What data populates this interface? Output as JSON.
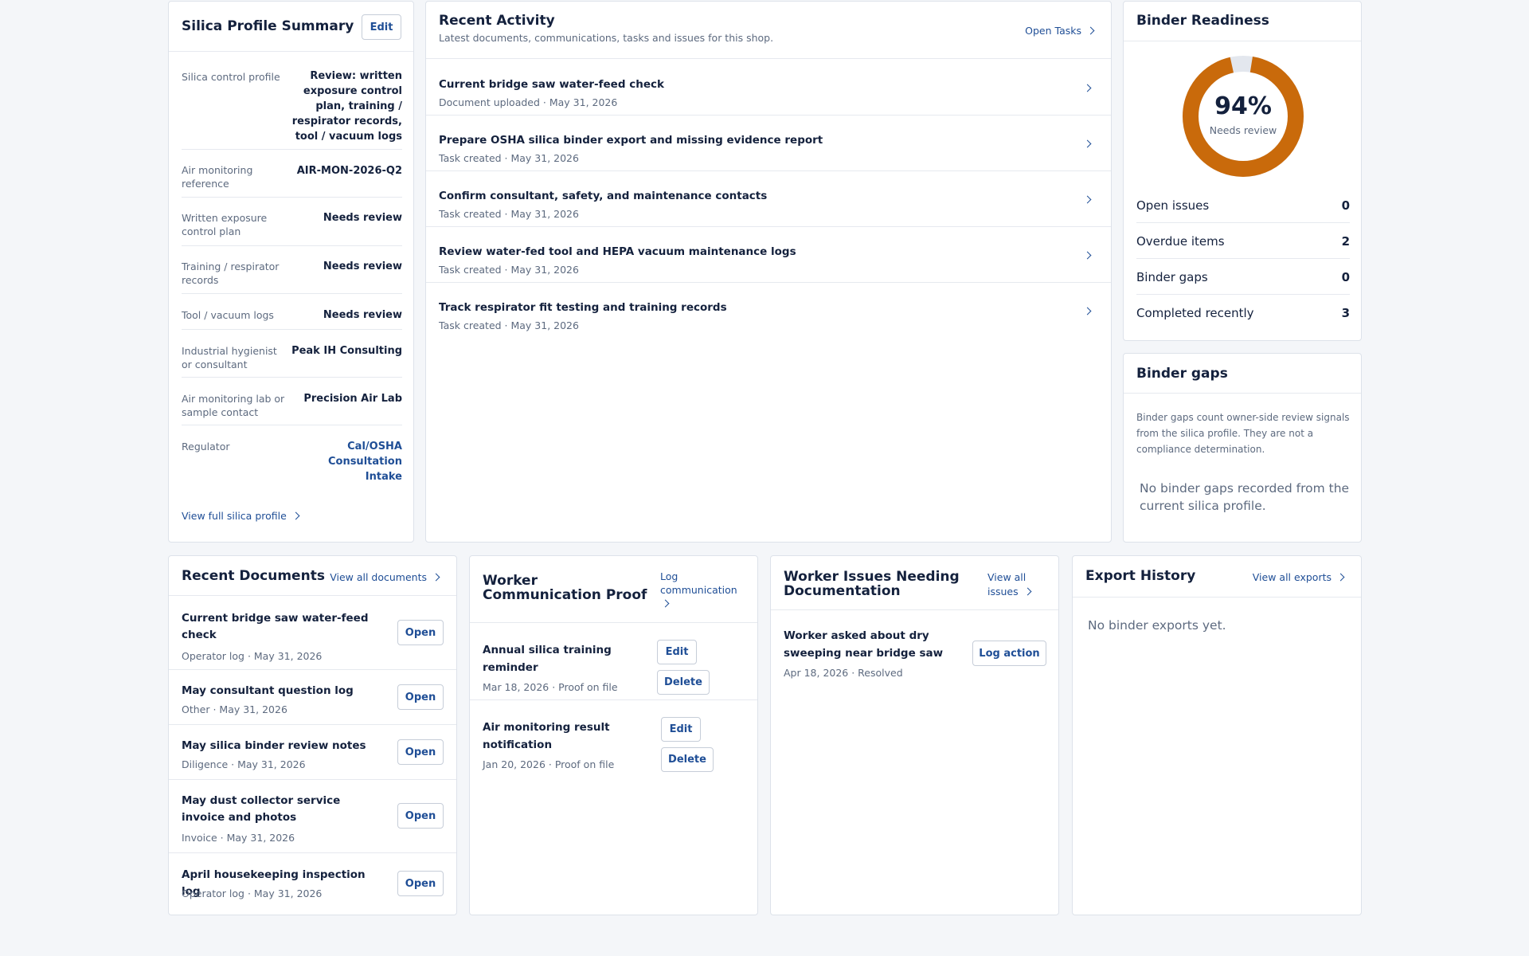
{
  "silica_profile": {
    "title": "Silica Profile Summary",
    "edit_label": "Edit",
    "rows": [
      {
        "label": "Silica control profile",
        "value": "Review: written exposure control plan, training / respirator records, tool / vacuum logs"
      },
      {
        "label": "Air monitoring reference",
        "value": "AIR-MON-2026-Q2"
      },
      {
        "label": "Written exposure control plan",
        "value": "Needs review"
      },
      {
        "label": "Training / respirator records",
        "value": "Needs review"
      },
      {
        "label": "Tool / vacuum logs",
        "value": "Needs review"
      },
      {
        "label": "Industrial hygienist or consultant",
        "value": "Peak IH Consulting"
      },
      {
        "label": "Air monitoring lab or sample contact",
        "value": "Precision Air Lab"
      },
      {
        "label": "Regulator",
        "value": "Cal/OSHA Consultation Intake"
      }
    ],
    "footer_link": "View full silica profile"
  },
  "recent_activity": {
    "title": "Recent Activity",
    "subtitle": "Latest documents, communications, tasks and issues for this shop.",
    "open_tasks_label": "Open Tasks",
    "items": [
      {
        "title": "Current bridge saw water-feed check",
        "meta": "Document uploaded · May 31, 2026"
      },
      {
        "title": "Prepare OSHA silica binder export and missing evidence report",
        "meta": "Task created · May 31, 2026"
      },
      {
        "title": "Confirm consultant, safety, and maintenance contacts",
        "meta": "Task created · May 31, 2026"
      },
      {
        "title": "Review water-fed tool and HEPA vacuum maintenance logs",
        "meta": "Task created · May 31, 2026"
      },
      {
        "title": "Track respirator fit testing and training records",
        "meta": "Task created · May 31, 2026"
      }
    ]
  },
  "binder_readiness": {
    "title": "Binder Readiness",
    "percent_value": 94,
    "percent_text": "94%",
    "status": "Needs review",
    "ring_color": "#c96a0b",
    "track_color": "#e3e7ee",
    "stats": [
      {
        "label": "Open issues",
        "value": "0"
      },
      {
        "label": "Overdue items",
        "value": "2"
      },
      {
        "label": "Binder gaps",
        "value": "0"
      },
      {
        "label": "Completed recently",
        "value": "3"
      }
    ]
  },
  "binder_gaps": {
    "title": "Binder gaps",
    "description": "Binder gaps count owner-side review signals from the silica profile. They are not a compliance determination.",
    "empty_text": "No binder gaps recorded from the current silica profile."
  },
  "recent_documents": {
    "title": "Recent Documents",
    "view_all_label": "View all documents",
    "open_label": "Open",
    "items": [
      {
        "title": "Current bridge saw water-feed check",
        "meta": "Operator log · May 31, 2026"
      },
      {
        "title": "May consultant question log",
        "meta": "Other · May 31, 2026"
      },
      {
        "title": "May silica binder review notes",
        "meta": "Diligence · May 31, 2026"
      },
      {
        "title": "May dust collector service invoice and photos",
        "meta": "Invoice · May 31, 2026"
      },
      {
        "title": "April housekeeping inspection log",
        "meta": "Operator log · May 31, 2026"
      }
    ]
  },
  "worker_communication": {
    "title": "Worker Communication Proof",
    "log_label": "Log communication",
    "edit_label": "Edit",
    "delete_label": "Delete",
    "items": [
      {
        "title": "Annual silica training reminder",
        "meta": "Mar 18, 2026 · Proof on file"
      },
      {
        "title": "Air monitoring result notification",
        "meta": "Jan 20, 2026 · Proof on file"
      }
    ]
  },
  "worker_issues": {
    "title": "Worker Issues Needing Documentation",
    "view_all_label": "View all issues",
    "action_label": "Log action",
    "items": [
      {
        "title": "Worker asked about dry sweeping near bridge saw",
        "meta": "Apr 18, 2026 · Resolved"
      }
    ]
  },
  "export_history": {
    "title": "Export History",
    "view_all_label": "View all exports",
    "empty_text": "No binder exports yet."
  }
}
